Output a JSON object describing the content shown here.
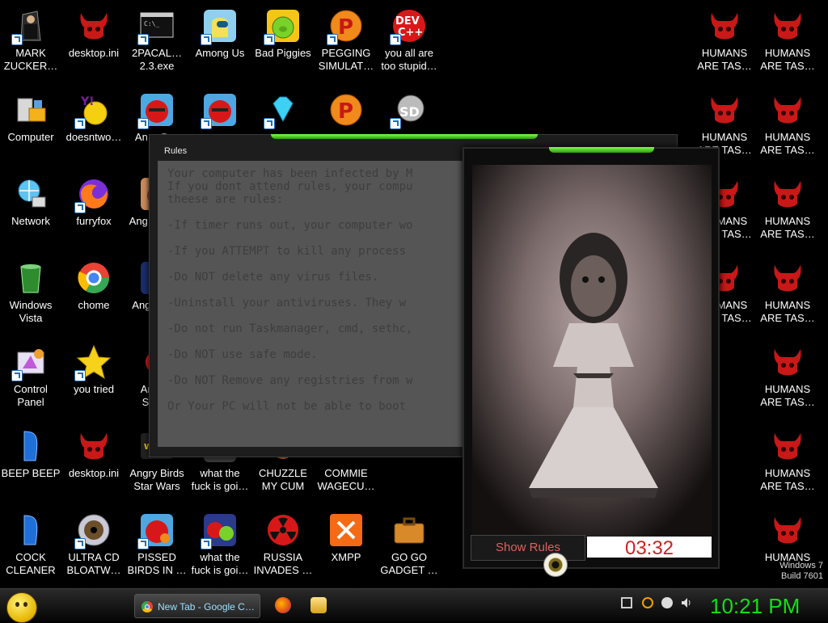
{
  "desktop": {
    "icons": [
      {
        "label": "MARK ZUCKER…",
        "icon": "mark-zuckerberg-icon"
      },
      {
        "label": "desktop.ini",
        "icon": "red-demon-icon"
      },
      {
        "label": "2PACAL… 2.3.exe",
        "icon": "console-exe-icon"
      },
      {
        "label": "Among Us",
        "icon": "among-us-icon"
      },
      {
        "label": "Bad Piggies",
        "icon": "bad-piggies-icon"
      },
      {
        "label": "PEGGING SIMULAT…",
        "icon": "pegging-simulator-icon"
      },
      {
        "label": "you all are too stupid…",
        "icon": "dev-cpp-icon"
      },
      {
        "label": "Computer",
        "icon": "computer-icon"
      },
      {
        "label": "doesntwo…",
        "icon": "yahoo-messenger-icon"
      },
      {
        "label": "An… B…",
        "icon": "angry-birds-icon"
      },
      {
        "label": "Network",
        "icon": "network-icon"
      },
      {
        "label": "furryfox",
        "icon": "firefox-icon"
      },
      {
        "label": "Ang… Se…",
        "icon": "angry-birds-seasons-icon"
      },
      {
        "label": "Windows Vista",
        "icon": "recycle-bin-icon"
      },
      {
        "label": "chome",
        "icon": "chrome-icon"
      },
      {
        "label": "Ang… S…",
        "icon": "angry-birds-space-icon"
      },
      {
        "label": "Control Panel",
        "icon": "control-panel-icon"
      },
      {
        "label": "you tried",
        "icon": "gold-star-icon"
      },
      {
        "label": "Angr… Star…",
        "icon": "angry-birds-star-icon"
      },
      {
        "label": "BEEP BEEP",
        "icon": "blue-bin-icon"
      },
      {
        "label": "desktop.ini",
        "icon": "red-demon-icon"
      },
      {
        "label": "Angry Birds Star Wars",
        "icon": "angry-birds-star-wars-icon"
      },
      {
        "label": "what the fuck is goi…",
        "icon": "game-icon"
      },
      {
        "label": "CHUZZLE MY CUM",
        "icon": "chuzzle-icon"
      },
      {
        "label": "COMMIE WAGECU…",
        "icon": "commie-icon"
      },
      {
        "label": "COCK CLEANER",
        "icon": "blue-bin-icon"
      },
      {
        "label": "ULTRA CD BLOATW…",
        "icon": "cd-disc-icon"
      },
      {
        "label": "PISSED BIRDS IN …",
        "icon": "pissed-birds-icon"
      },
      {
        "label": "what the fuck is goi…",
        "icon": "angry-birds-pigs-icon"
      },
      {
        "label": "RUSSIA INVADES …",
        "icon": "radiation-icon"
      },
      {
        "label": "XMPP",
        "icon": "xampp-icon"
      },
      {
        "label": "GO GO GADGET …",
        "icon": "briefcase-icon"
      },
      {
        "label": "HUMANS ARE TAS…",
        "icon": "red-demon-icon"
      },
      {
        "label": "HUMANS ARE TAS…",
        "icon": "red-demon-icon"
      },
      {
        "label": "HUMANS ARE TAS…",
        "icon": "red-demon-icon"
      },
      {
        "label": "HUMANS ARE TAS…",
        "icon": "red-demon-icon"
      },
      {
        "label": "HUMANS ARE TAS…",
        "icon": "red-demon-icon"
      },
      {
        "label": "HUMANS ARE TAS…",
        "icon": "red-demon-icon"
      },
      {
        "label": "HUMANS ARE TAS…",
        "icon": "red-demon-icon"
      },
      {
        "label": "HUMANS ARE TAS…",
        "icon": "red-demon-icon"
      },
      {
        "label": "HUMANS ARE TAS…",
        "icon": "red-demon-icon"
      },
      {
        "label": "HUMANS ARE TAS…",
        "icon": "red-demon-icon"
      },
      {
        "label": "HUMANS ARE TAS…",
        "icon": "red-demon-icon"
      },
      {
        "label": "HUMANS",
        "icon": "red-demon-icon"
      }
    ]
  },
  "rules_window": {
    "title": "Rules",
    "lines": [
      "Your computer has been infected by M",
      "If you dont attend rules, your compu",
      "theese are rules:",
      "-If timer runs out, your computer wo",
      "-If you ATTEMPT to kill any process",
      "-Do NOT delete any virus files.",
      "-Uninstall your antiviruses. They w",
      "-Do not run Taskmanager, cmd, sethc,",
      "-Do NOT use safe mode.",
      "-Do NOT Remove any registries from w",
      "Or Your PC will not be able to boot"
    ]
  },
  "ghost_window": {
    "show_rules_label": "Show Rules",
    "timer": "03:32"
  },
  "taskbar": {
    "tasks": [
      {
        "label": "New Tab - Google C…",
        "icon": "chrome-icon"
      },
      {
        "label": "",
        "icon": "firefox-icon"
      },
      {
        "label": "",
        "icon": "explorer-folder-icon"
      }
    ],
    "clock": "10:21 PM"
  },
  "watermark": {
    "line1": "Windows 7",
    "line2": "Build 7601"
  },
  "colors": {
    "accent_green": "#2e9a0f",
    "clock_green": "#12e012",
    "timer_red": "#d02020",
    "demon_red": "#c81818"
  }
}
